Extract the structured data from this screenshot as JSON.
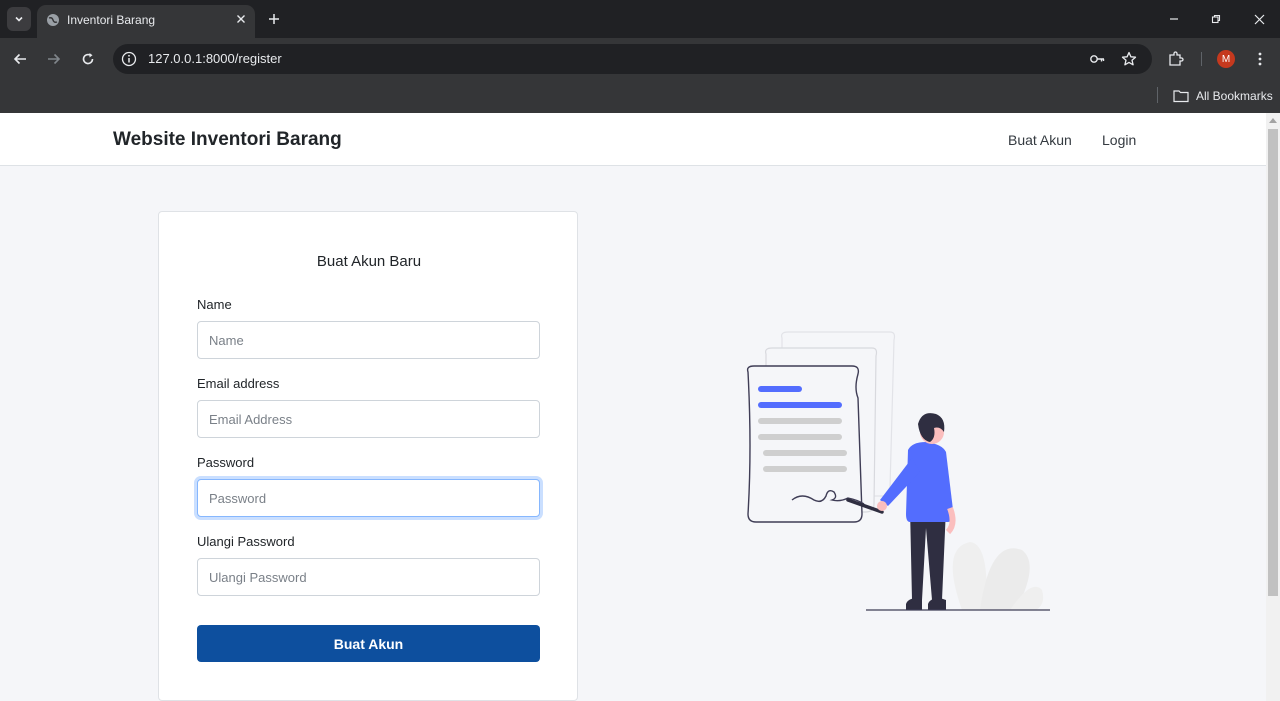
{
  "browser": {
    "tab_title": "Inventori Barang",
    "url": "127.0.0.1:8000/register",
    "profile_initial": "M",
    "bookmarks_label": "All Bookmarks"
  },
  "navbar": {
    "brand": "Website Inventori Barang",
    "links": [
      "Buat Akun",
      "Login"
    ]
  },
  "form": {
    "title": "Buat Akun Baru",
    "fields": [
      {
        "label": "Name",
        "placeholder": "Name",
        "value": ""
      },
      {
        "label": "Email address",
        "placeholder": "Email Address",
        "value": ""
      },
      {
        "label": "Password",
        "placeholder": "Password",
        "value": ""
      },
      {
        "label": "Ulangi Password",
        "placeholder": "Ulangi Password",
        "value": ""
      }
    ],
    "submit_label": "Buat Akun"
  },
  "colors": {
    "primary_button": "#0d4f9e",
    "illustration_accent": "#536dfe"
  }
}
